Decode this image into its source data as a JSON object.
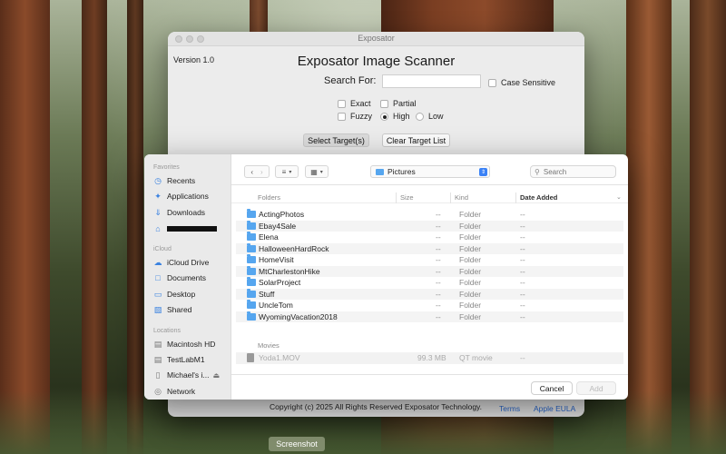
{
  "app": {
    "window_title": "Exposator",
    "version": "Version 1.0",
    "heading": "Exposator Image Scanner",
    "search_label": "Search For:",
    "search_value": "",
    "case_sensitive_label": "Case Sensitive",
    "options": {
      "exact": "Exact",
      "partial": "Partial",
      "fuzzy": "Fuzzy",
      "high": "High",
      "low": "Low"
    },
    "select_targets_label": "Select Target(s)",
    "clear_target_list_label": "Clear Target List",
    "footer": {
      "copyright": "Copyright (c) 2025 All Rights Reserved Exposator Technology.",
      "terms": "Terms",
      "eula": "Apple EULA"
    }
  },
  "dialog": {
    "sidebar": {
      "favorites_title": "Favorites",
      "favorites": [
        {
          "label": "Recents",
          "icon": "clock-icon"
        },
        {
          "label": "Applications",
          "icon": "applications-icon"
        },
        {
          "label": "Downloads",
          "icon": "download-icon"
        }
      ],
      "icloud_title": "iCloud",
      "icloud": [
        {
          "label": "iCloud Drive",
          "icon": "cloud-icon"
        },
        {
          "label": "Documents",
          "icon": "document-icon"
        },
        {
          "label": "Desktop",
          "icon": "desktop-icon"
        },
        {
          "label": "Shared",
          "icon": "shared-folder-icon"
        }
      ],
      "locations_title": "Locations",
      "locations": [
        {
          "label": "Macintosh HD",
          "icon": "disk-icon"
        },
        {
          "label": "TestLabM1",
          "icon": "disk-icon"
        },
        {
          "label": "Michael's i...",
          "icon": "computer-icon"
        },
        {
          "label": "Network",
          "icon": "globe-icon"
        }
      ]
    },
    "toolbar": {
      "path": "Pictures",
      "search_placeholder": "Search"
    },
    "columns": {
      "name": "Folders",
      "size": "Size",
      "kind": "Kind",
      "date": "Date Added"
    },
    "folders": [
      {
        "name": "ActingPhotos",
        "size": "--",
        "kind": "Folder",
        "date": "--"
      },
      {
        "name": "Ebay4Sale",
        "size": "--",
        "kind": "Folder",
        "date": "--"
      },
      {
        "name": "Elena",
        "size": "--",
        "kind": "Folder",
        "date": "--"
      },
      {
        "name": "HalloweenHardRock",
        "size": "--",
        "kind": "Folder",
        "date": "--"
      },
      {
        "name": "HomeVisit",
        "size": "--",
        "kind": "Folder",
        "date": "--"
      },
      {
        "name": "MtCharlestonHike",
        "size": "--",
        "kind": "Folder",
        "date": "--"
      },
      {
        "name": "SolarProject",
        "size": "--",
        "kind": "Folder",
        "date": "--"
      },
      {
        "name": "Stuff",
        "size": "--",
        "kind": "Folder",
        "date": "--"
      },
      {
        "name": "UncleTom",
        "size": "--",
        "kind": "Folder",
        "date": "--"
      },
      {
        "name": "WyomingVacation2018",
        "size": "--",
        "kind": "Folder",
        "date": "--"
      }
    ],
    "movies_title": "Movies",
    "movie": {
      "name": "Yoda1.MOV",
      "size": "99.3 MB",
      "kind": "QT movie",
      "date": "--"
    },
    "cancel_label": "Cancel",
    "add_label": "Add"
  },
  "screenshot_label": "Screenshot"
}
